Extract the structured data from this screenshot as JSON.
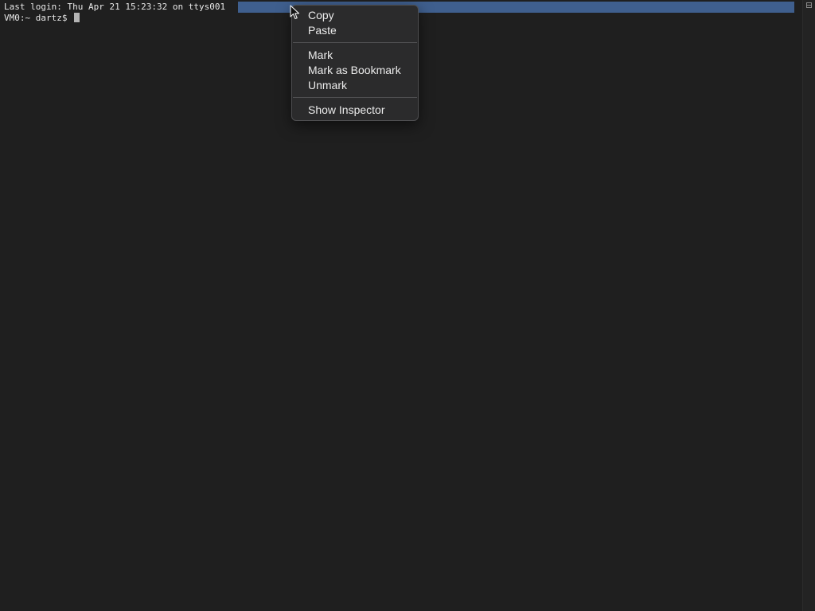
{
  "terminal": {
    "lines": [
      "Last login: Thu Apr 21 15:23:32 on ttys001",
      "VM0:~ dartz$ "
    ]
  },
  "context_menu": {
    "items": [
      {
        "label": "Copy"
      },
      {
        "label": "Paste"
      },
      {
        "label": "Mark"
      },
      {
        "label": "Mark as Bookmark"
      },
      {
        "label": "Unmark"
      },
      {
        "label": "Show Inspector"
      }
    ]
  },
  "icons": {
    "scrollbar_split": "split-pane-icon",
    "pointer": "mouse-pointer-icon"
  },
  "colors": {
    "background": "#1f1f1f",
    "selection": "#3f5f8e",
    "menu_background": "#2b2b2c",
    "text": "#e8e8e8"
  }
}
